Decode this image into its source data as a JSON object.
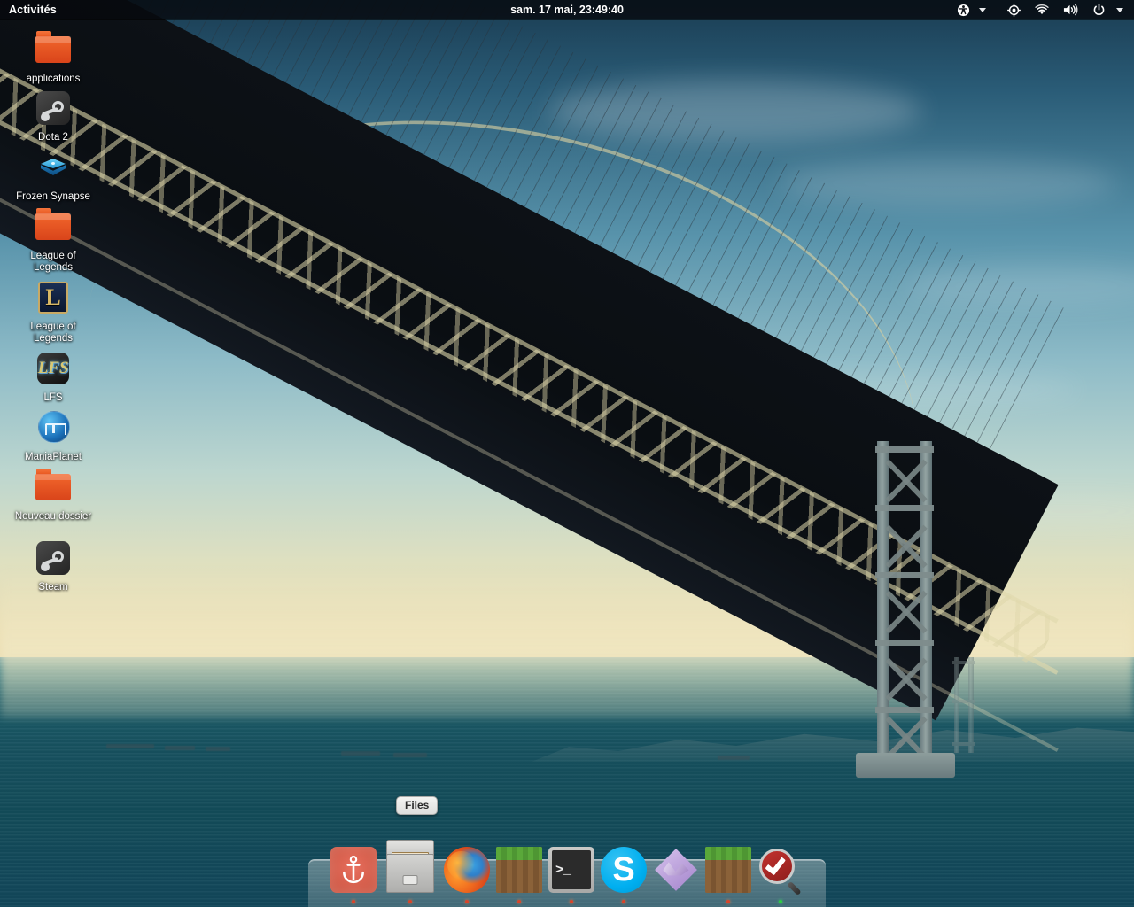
{
  "top_panel": {
    "activities_label": "Activités",
    "clock": "sam. 17 mai, 23:49:40",
    "tray": [
      {
        "name": "accessibility-icon",
        "label": "Accessibilité"
      },
      {
        "name": "chevron-down-icon",
        "label": "Menu"
      },
      {
        "name": "location-icon",
        "label": "Localisation"
      },
      {
        "name": "wifi-icon",
        "label": "Réseau sans fil"
      },
      {
        "name": "volume-icon",
        "label": "Volume"
      },
      {
        "name": "power-icon",
        "label": "Alimentation"
      },
      {
        "name": "chevron-down-icon",
        "label": "Menu système"
      }
    ]
  },
  "desktop_icons": [
    {
      "label": "applications",
      "icon": "folder-icon"
    },
    {
      "label": "Dota 2",
      "icon": "steam-game-icon"
    },
    {
      "label": "Frozen Synapse",
      "icon": "frozen-synapse-icon"
    },
    {
      "label": "League of Legends",
      "icon": "folder-icon"
    },
    {
      "label": "League of Legends",
      "icon": "league-of-legends-icon"
    },
    {
      "label": "LFS",
      "icon": "lfs-icon"
    },
    {
      "label": "ManiaPlanet",
      "icon": "maniaplanet-icon"
    },
    {
      "label": "Nouveau dossier",
      "icon": "folder-icon"
    },
    {
      "label": "Steam",
      "icon": "steam-icon"
    }
  ],
  "dock": {
    "tooltip": "Files",
    "items": [
      {
        "name": "docky-anchor",
        "label": "Docky",
        "running": true,
        "indicator_color": "#d9442a"
      },
      {
        "name": "files",
        "label": "Files",
        "running": true,
        "indicator_color": "#d9442a"
      },
      {
        "name": "firefox",
        "label": "Firefox",
        "running": true,
        "indicator_color": "#d9442a"
      },
      {
        "name": "minecraft",
        "label": "Minecraft",
        "running": true,
        "indicator_color": "#d9442a"
      },
      {
        "name": "terminal",
        "label": "Terminal",
        "running": true,
        "indicator_color": "#d9442a"
      },
      {
        "name": "skype",
        "label": "Skype",
        "running": true,
        "indicator_color": "#d9442a"
      },
      {
        "name": "purple-diamond",
        "label": "Application",
        "running": false,
        "indicator_color": "#d9442a"
      },
      {
        "name": "minecraft-alt",
        "label": "Minecraft",
        "running": true,
        "indicator_color": "#d9442a"
      },
      {
        "name": "clamtk",
        "label": "ClamTk",
        "running": true,
        "indicator_color": "#2ecc41"
      }
    ]
  },
  "colors": {
    "panel_background": "#06090e",
    "panel_text": "#ffffff",
    "folder_orange": "#f2672c",
    "dock_plate": "#dae0e0",
    "indicator_running": "#d9442a",
    "indicator_active": "#2ecc41"
  },
  "wallpaper": {
    "subject": "Akashi Kaikyo suspension bridge over the sea at dusk"
  }
}
